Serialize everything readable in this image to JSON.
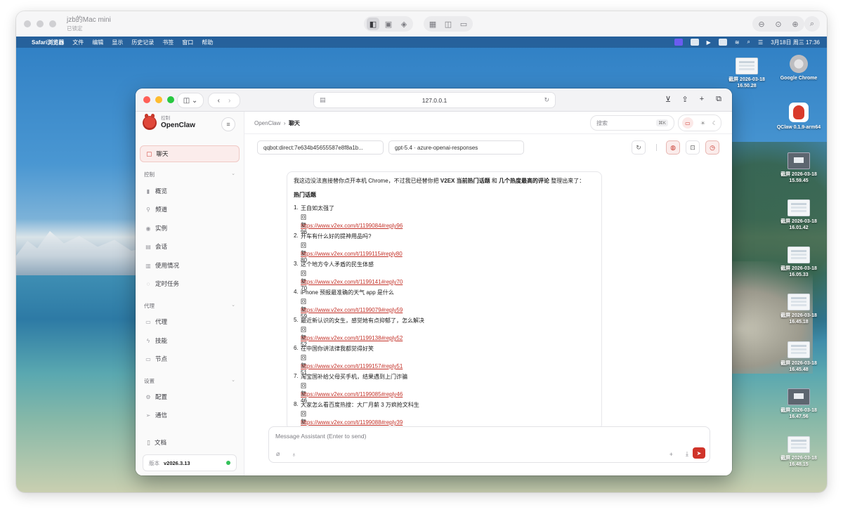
{
  "outer": {
    "title": "jzb的Mac mini",
    "subtitle": "已锁定"
  },
  "menubar": {
    "app_name": "Safari浏览器",
    "items": [
      "文件",
      "编辑",
      "显示",
      "历史记录",
      "书签",
      "窗口",
      "帮助"
    ],
    "clock": "3月18日 周三  17:36"
  },
  "desktop_icons": [
    {
      "label": "截屏 2026-03-18 16.50.28",
      "icon": "screenshot-thumb"
    },
    {
      "label": "Google Chrome",
      "icon": "chrome-app-icon"
    },
    {
      "label": "QClaw 0.1.9-arm64",
      "icon": "qclaw-app-icon"
    },
    {
      "label": "截屏 2026-03-18 15.59.45",
      "icon": "screenshot-thumb"
    },
    {
      "label": "截屏 2026-03-18 16.01.42",
      "icon": "screenshot-thumb"
    },
    {
      "label": "截屏 2026-03-18 16.05.33",
      "icon": "screenshot-thumb"
    },
    {
      "label": "截屏 2026-03-18 16.45.18",
      "icon": "screenshot-thumb"
    },
    {
      "label": "截屏 2026-03-18 16.45.48",
      "icon": "screenshot-thumb"
    },
    {
      "label": "截屏 2026-03-18 16.47.56",
      "icon": "screenshot-thumb"
    },
    {
      "label": "截屏 2026-03-18 16.48.15",
      "icon": "screenshot-thumb"
    }
  ],
  "safari": {
    "address": "127.0.0.1"
  },
  "brand": {
    "small": "控制",
    "name": "OpenClaw"
  },
  "sidebar": {
    "active": "聊天",
    "sections": [
      {
        "title": "控制",
        "items": [
          "概览",
          "频道",
          "实例",
          "会话",
          "使用情况",
          "定时任务"
        ]
      },
      {
        "title": "代理",
        "items": [
          "代理",
          "技能",
          "节点"
        ]
      },
      {
        "title": "设置",
        "items": [
          "配置",
          "通信"
        ]
      }
    ],
    "docs": "文档",
    "version_label": "版本",
    "version": "v2026.3.13"
  },
  "header": {
    "crumb_root": "OpenClaw",
    "crumb_sep": "›",
    "crumb_current": "聊天",
    "search_placeholder": "搜索",
    "search_kbd": "⌘K"
  },
  "session": {
    "session_key": "qqbot:direct:7e634b45655587e8f8a1b...",
    "model": "gpt-5.4 · azure-openai-responses"
  },
  "message": {
    "intro_a": "我这边没法直接替你点开本机 Chrome，不过我已经替你把 ",
    "intro_b": "V2EX 当前热门话题",
    "intro_c": " 和 ",
    "intro_d": "几个热度最高的评论",
    "intro_e": " 整理出来了：",
    "heading": "热门话题",
    "items": [
      {
        "num": "1.",
        "title": "王自如太强了",
        "replies": "回复 96",
        "url": "https://www.v2ex.com/t/1199084#reply96"
      },
      {
        "num": "2.",
        "title": "开车有什么好的提神用品吗?",
        "replies": "回复 80",
        "url": "https://www.v2ex.com/t/1199115#reply80"
      },
      {
        "num": "3.",
        "title": "这个地方令人矛盾的民生体感",
        "replies": "回复 70",
        "url": "https://www.v2ex.com/t/1199141#reply70"
      },
      {
        "num": "4.",
        "title": "iPhone 预报最准确的天气 app 是什么",
        "replies": "回复 59",
        "url": "https://www.v2ex.com/t/1199079#reply59"
      },
      {
        "num": "5.",
        "title": "最近新认识的女生，感觉她有点抑郁了，怎么解决",
        "replies": "回复 52",
        "url": "https://www.v2ex.com/t/1199138#reply52"
      },
      {
        "num": "6.",
        "title": "在中国你讲法律我都觉得好笑",
        "replies": "回复 51",
        "url": "https://www.v2ex.com/t/1199157#reply51"
      },
      {
        "num": "7.",
        "title": "淘宝国补给父母买手机，结果遇到上门诈骗",
        "replies": "回复 46",
        "url": "https://www.v2ex.com/t/1199085#reply46"
      },
      {
        "num": "8.",
        "title": "大家怎么看百度热搜：大厂月薪 3 万疯抢文科生",
        "replies": "回复 39",
        "url": "https://www.v2ex.com/t/1199088#reply39"
      }
    ]
  },
  "composer": {
    "placeholder": "Message Assistant (Enter to send)"
  },
  "colors": {
    "accent": "#d0342a",
    "link": "#c4332a",
    "online": "#33c15a"
  }
}
